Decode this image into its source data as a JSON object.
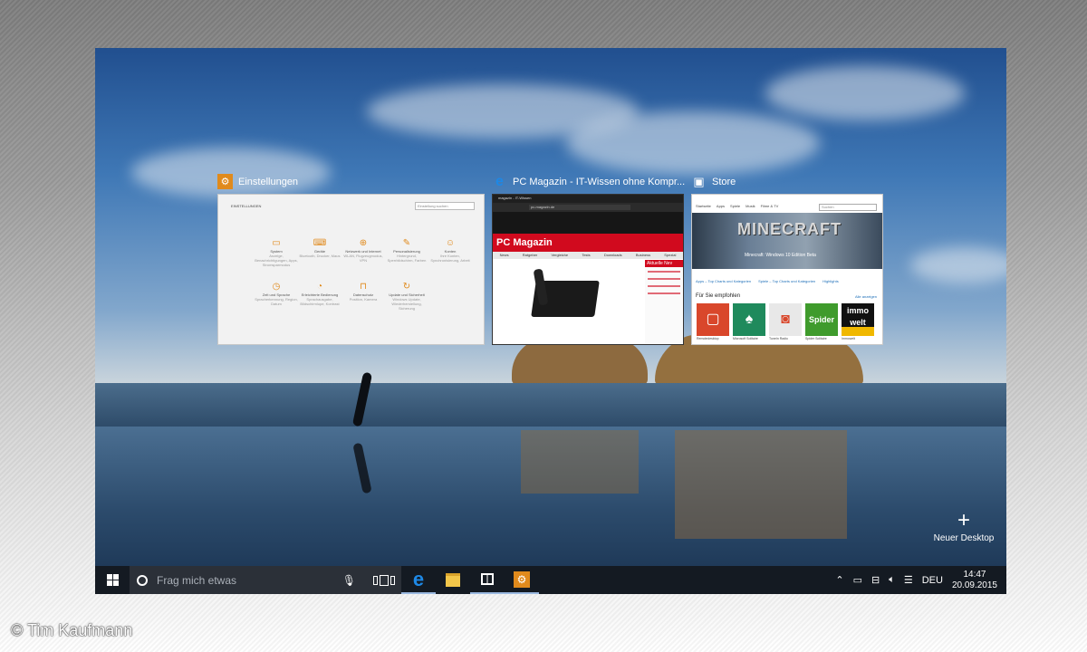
{
  "windows": [
    {
      "title": "Einstellungen",
      "icon": "gear-icon",
      "color": "#e08a1c"
    },
    {
      "title": "PC Magazin - IT-Wissen ohne Kompr...",
      "icon": "edge-icon",
      "color": "#1e88e5"
    },
    {
      "title": "Store",
      "icon": "store-icon",
      "color": "#ffffff"
    }
  ],
  "settings_thumb": {
    "heading": "EINSTELLUNGEN",
    "search_placeholder": "Einstellung suchen",
    "items": [
      {
        "icon": "laptop-icon",
        "label": "System",
        "sub": "Anzeige, Benachrichtigungen, Apps, Stromsparmodus"
      },
      {
        "icon": "devices-icon",
        "label": "Geräte",
        "sub": "Bluetooth, Drucker, Maus"
      },
      {
        "icon": "globe-icon",
        "label": "Netzwerk und Internet",
        "sub": "WLAN, Flugzeugmodus, VPN"
      },
      {
        "icon": "brush-icon",
        "label": "Personalisierung",
        "sub": "Hintergrund, Sperrbildschirm, Farben"
      },
      {
        "icon": "person-icon",
        "label": "Konten",
        "sub": "Ihre Konten, Synchronisierung, Arbeit"
      },
      {
        "icon": "clock-icon",
        "label": "Zeit und Sprache",
        "sub": "Spracherkennung, Region, Datum"
      },
      {
        "icon": "ease-icon",
        "label": "Erleichterte Bedienung",
        "sub": "Sprachausgabe, Bildschirmlupe, Kontrast"
      },
      {
        "icon": "lock-icon",
        "label": "Datenschutz",
        "sub": "Position, Kamera"
      },
      {
        "icon": "refresh-icon",
        "label": "Update und Sicherheit",
        "sub": "Windows Update, Wiederherstellung, Sicherung"
      }
    ]
  },
  "browser_thumb": {
    "tab": "magazin - IT-Wissen",
    "address": "pc-magazin.de",
    "logo": "PC Magazin",
    "nav": [
      "News",
      "Ratgeber",
      "Vergleiche",
      "Tests",
      "Downloads",
      "Business",
      "Spezial"
    ],
    "side_heading": "Aktuelle Nev"
  },
  "store_thumb": {
    "search": "Suchen",
    "nav": [
      "Startseite",
      "Apps",
      "Spiele",
      "Musik",
      "Filme & TV"
    ],
    "banner_title": "MINECRAFT",
    "banner_caption": "Minecraft: Windows 10 Edition Beta",
    "links": [
      "Apps – Top Charts und Kategorien",
      "Spiele – Top Charts und Kategorien",
      "Highlights"
    ],
    "section": "Für Sie empfohlen",
    "section_more": "Alle anzeigen",
    "apps": [
      {
        "name": "Remotedesktop",
        "tile": "",
        "color": "#d9472b"
      },
      {
        "name": "Microsoft Solitaire",
        "tile": "",
        "color": "#1f8a5c"
      },
      {
        "name": "TuneIn Radio",
        "tile": "",
        "color": "#e8e8e8"
      },
      {
        "name": "Spider Solitaire",
        "tile": "Spider",
        "color": "#3f9b2c"
      },
      {
        "name": "Immowelt",
        "tile": "immo welt",
        "color": "#f0b800"
      }
    ]
  },
  "new_desktop": {
    "icon": "plus-icon",
    "label": "Neuer Desktop"
  },
  "taskbar": {
    "start_icon": "windows-logo-icon",
    "search_placeholder": "Frag mich etwas",
    "pinned": [
      {
        "name": "taskbar-edge",
        "icon": "edge-icon",
        "glyph": "e"
      },
      {
        "name": "taskbar-explorer",
        "icon": "folder-icon",
        "glyph": ""
      },
      {
        "name": "taskbar-store",
        "icon": "store-icon",
        "glyph": ""
      },
      {
        "name": "taskbar-settings",
        "icon": "gear-icon",
        "glyph": "⚙"
      }
    ],
    "language": "DEU",
    "time": "14:47",
    "date": "20.09.2015"
  },
  "copyright": "© Tim Kaufmann"
}
